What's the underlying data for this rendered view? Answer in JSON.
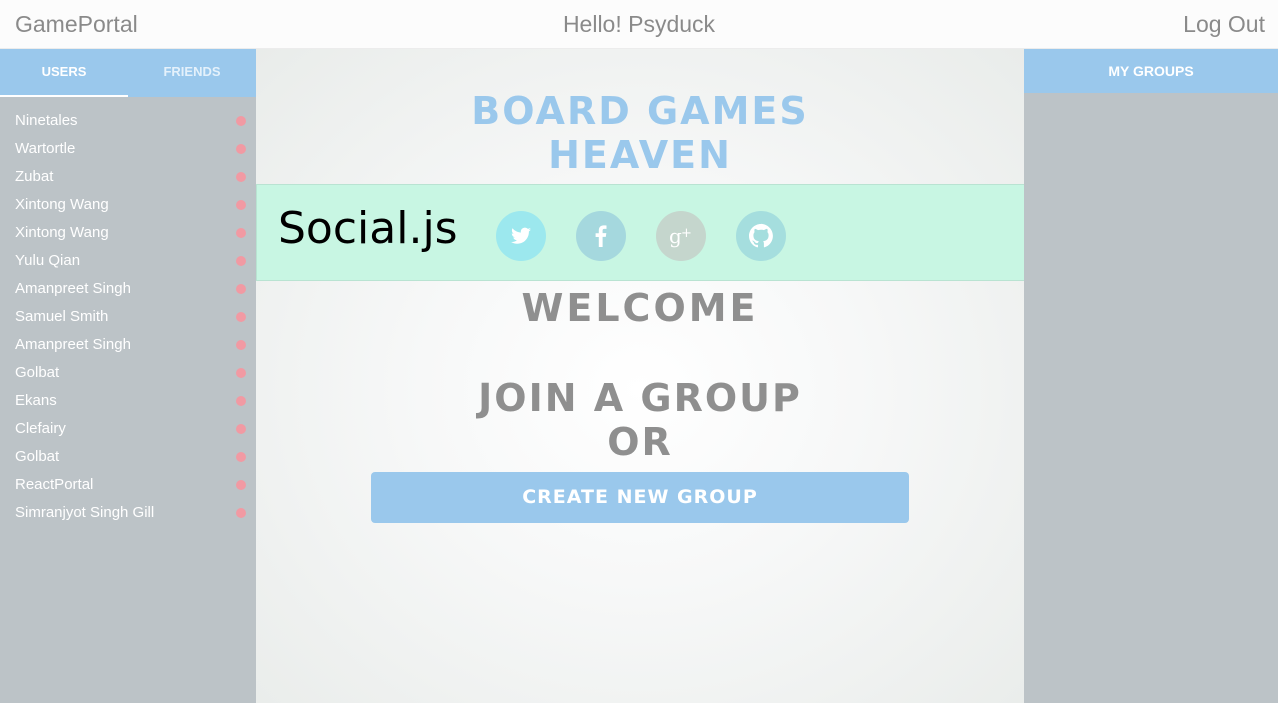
{
  "topbar": {
    "brand": "GamePortal",
    "greeting": "Hello! Psyduck",
    "logout": "Log Out"
  },
  "sidebar": {
    "tabs": [
      {
        "label": "USERS",
        "active": true
      },
      {
        "label": "FRIENDS",
        "active": false
      }
    ],
    "users": [
      {
        "name": "Ninetales",
        "status": "offline"
      },
      {
        "name": "Wartortle",
        "status": "offline"
      },
      {
        "name": "Zubat",
        "status": "offline"
      },
      {
        "name": "Xintong Wang",
        "status": "offline"
      },
      {
        "name": "Xintong Wang",
        "status": "offline"
      },
      {
        "name": "Yulu Qian",
        "status": "offline"
      },
      {
        "name": "Amanpreet Singh",
        "status": "offline"
      },
      {
        "name": "Samuel Smith",
        "status": "offline"
      },
      {
        "name": "Amanpreet Singh",
        "status": "offline"
      },
      {
        "name": "Golbat",
        "status": "offline"
      },
      {
        "name": "Ekans",
        "status": "offline"
      },
      {
        "name": "Clefairy",
        "status": "offline"
      },
      {
        "name": "Golbat",
        "status": "offline"
      },
      {
        "name": "ReactPortal",
        "status": "offline"
      },
      {
        "name": "Simranjyot Singh Gill",
        "status": "offline"
      }
    ],
    "status_color": "#f19aa3"
  },
  "main": {
    "title_line1": "BOARD GAMES",
    "title_line2": "HEAVEN",
    "social": {
      "label": "Social.js",
      "buttons": [
        {
          "icon": "twitter-icon"
        },
        {
          "icon": "facebook-icon"
        },
        {
          "icon": "google-plus-icon"
        },
        {
          "icon": "github-icon"
        }
      ]
    },
    "welcome": "WELCOME",
    "join_line1": "JOIN A GROUP",
    "join_line2": "OR",
    "create_button": "CREATE NEW GROUP"
  },
  "right_panel": {
    "header": "MY GROUPS"
  },
  "colors": {
    "accent": "#9ac8ec",
    "panel_bg": "#bcc3c7",
    "social_bg": "#c8f6e3"
  }
}
